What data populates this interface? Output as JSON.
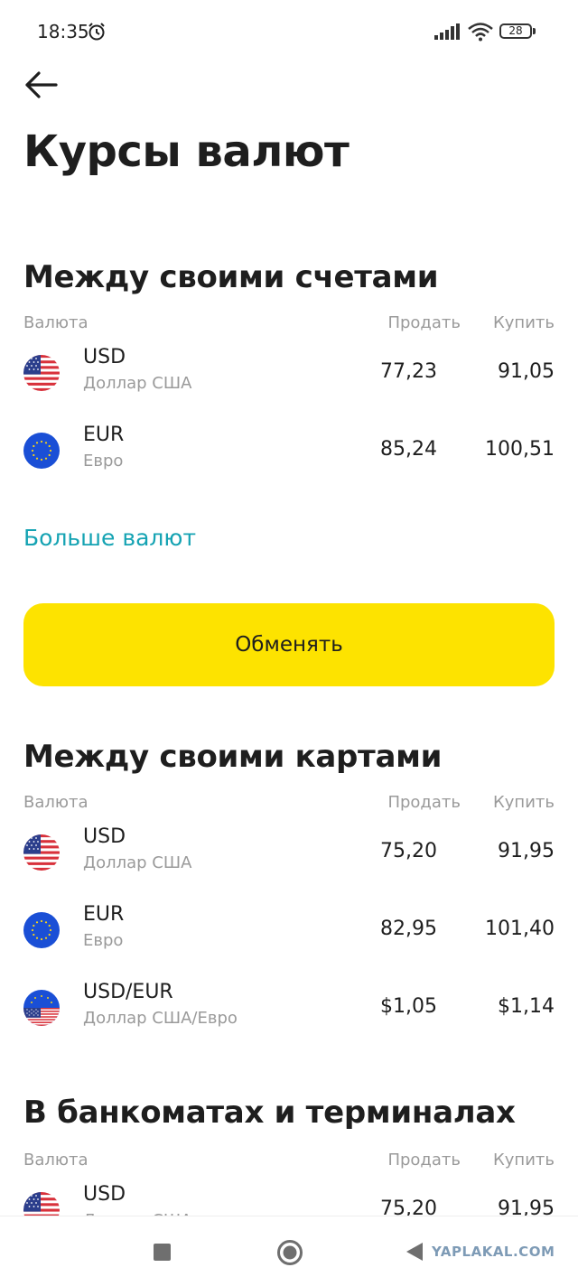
{
  "status_bar": {
    "time": "18:35",
    "battery": "28"
  },
  "page": {
    "title": "Курсы валют"
  },
  "accounts": {
    "title": "Между своими счетами",
    "headers": {
      "currency": "Валюта",
      "sell": "Продать",
      "buy": "Купить"
    },
    "rows": [
      {
        "code": "USD",
        "name": "Доллар США",
        "sell": "77,23",
        "buy": "91,05",
        "flag": "us-flag-icon"
      },
      {
        "code": "EUR",
        "name": "Евро",
        "sell": "85,24",
        "buy": "100,51",
        "flag": "eu-flag-icon"
      }
    ],
    "more_link": "Больше валют",
    "exchange_button": "Обменять"
  },
  "cards": {
    "title": "Между своими картами",
    "headers": {
      "currency": "Валюта",
      "sell": "Продать",
      "buy": "Купить"
    },
    "rows": [
      {
        "code": "USD",
        "name": "Доллар США",
        "sell": "75,20",
        "buy": "91,95",
        "flag": "us-flag-icon"
      },
      {
        "code": "EUR",
        "name": "Евро",
        "sell": "82,95",
        "buy": "101,40",
        "flag": "eu-flag-icon"
      },
      {
        "code": "USD/EUR",
        "name": "Доллар США/Евро",
        "sell": "$1,05",
        "buy": "$1,14",
        "flag": "us-eu-flag-icon"
      }
    ]
  },
  "atm": {
    "title": "В банкоматах и терминалах",
    "headers": {
      "currency": "Валюта",
      "sell": "Продать",
      "buy": "Купить"
    },
    "rows": [
      {
        "code": "USD",
        "name": "Доллар США",
        "sell": "75,20",
        "buy": "91,95",
        "flag": "us-flag-icon"
      }
    ]
  },
  "watermark": "YAPLAKAL.COM",
  "colors": {
    "accent_yellow": "#fde300",
    "link_teal": "#15a3b3",
    "text_dark": "#1e1e1e",
    "text_muted": "#9a9a9a"
  }
}
